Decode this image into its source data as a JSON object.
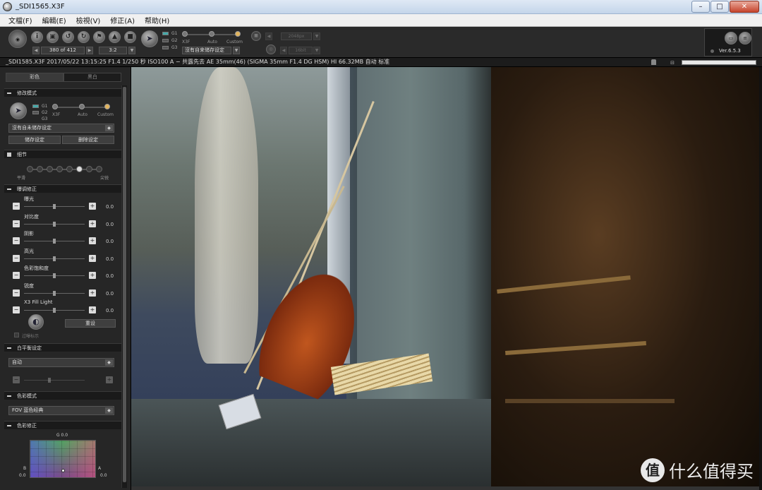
{
  "window": {
    "title": "_SDI1565.X3F"
  },
  "menu": [
    "文檔(F)",
    "編輯(E)",
    "檢視(V)",
    "修正(A)",
    "帮助(H)"
  ],
  "toolbar": {
    "counter": "380 of 412",
    "ratio": "3:2",
    "g_labels": [
      "G1",
      "G2",
      "G3"
    ],
    "preset_labels": [
      "X3F",
      "Auto",
      "Custom"
    ],
    "preset_dropdown": "沒有自来储存设定",
    "dim_fields": [
      "2048px",
      "16bit"
    ],
    "version": "Ver.6.5.3"
  },
  "infobar": {
    "text": "_SDI1585.X3F 2017/05/22 13:15:25 F1.4 1/250 秒 ISO100 A − 共露先去 AE 35mm(46) (SIGMA 35mm F1.4 DG HSM) HI 66.32MB 自动 标准"
  },
  "left_panel": {
    "tabs": [
      "彩色",
      "黑白"
    ],
    "sections": {
      "modify_mode": "修改模式",
      "detail": "细节",
      "exposure": "曝调修正",
      "white_balance": "白平衡设定",
      "color_mode": "色彩模式",
      "color_correction": "色彩修正"
    },
    "g_labels": [
      "G1",
      "G2",
      "G3"
    ],
    "preset_labels": [
      "X3F",
      "Auto",
      "Custom"
    ],
    "preset_dropdown": "沒有自未储存设定",
    "save_button": "储存设定",
    "delete_button": "删除设定",
    "detail_left": "平滑",
    "detail_right": "尖锐",
    "adjustments": [
      {
        "label": "曝光",
        "value": "0.0"
      },
      {
        "label": "对比度",
        "value": "0.0"
      },
      {
        "label": "阴影",
        "value": "0.0"
      },
      {
        "label": "高光",
        "value": "0.0"
      },
      {
        "label": "色彩饱和度",
        "value": "0.0"
      },
      {
        "label": "锐度",
        "value": "0.0"
      },
      {
        "label": "X3 Fill Light",
        "value": "0.0"
      }
    ],
    "reset_button": "重设",
    "overexposure_label": "过曝标示",
    "wb_dropdown": "自动",
    "color_mode_dropdown": "FOV 蓝色经典",
    "cc_g_label": "G 0.0",
    "cc_b_label": "B",
    "cc_a_label": "A",
    "cc_b_value": "0.0",
    "cc_a_value": "0.0"
  },
  "watermark": {
    "text": "什么值得买",
    "logo": "值"
  },
  "colors": {
    "accent": "#e2b45c",
    "panel": "#262626",
    "toolbar": "#2a2a2a"
  },
  "icons": [
    "logo-icon",
    "info-icon",
    "camera-icon",
    "rotate-left-icon",
    "rotate-right-icon",
    "flag-icon",
    "lock-icon",
    "trash-icon",
    "sigma-icon",
    "stop-icon"
  ]
}
